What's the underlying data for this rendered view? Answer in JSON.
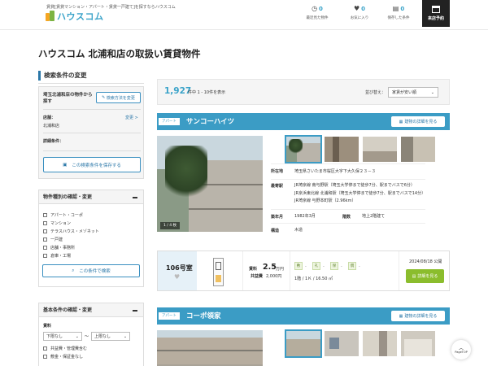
{
  "header": {
    "tagline": "賃貸[賃貸マンション・アパート・賃貸一戸建て]を探すならハウスコム",
    "logo_text": "ハウスコム",
    "recent": {
      "count": "0",
      "label": "最近見た物件"
    },
    "favorites": {
      "count": "0",
      "label": "お気に入り"
    },
    "saved": {
      "count": "0",
      "label": "保存した条件"
    },
    "visit_label": "来店予約"
  },
  "page_title": "ハウスコム 北浦和店の取扱い賃貸物件",
  "sidebar": {
    "heading": "検索条件の変更",
    "store_box": {
      "title": "埼玉北浦和店の物件から探す",
      "change_method": "検索方法を変更",
      "store_key": "店舗：",
      "store_edit": "変更 >",
      "store_value": "北浦和店",
      "detail_key": "詳細条件：",
      "save_button": "この検索条件を保存する"
    },
    "type_section": {
      "title": "物件種別の確認・変更",
      "options": [
        "アパート・コーポ",
        "マンション",
        "テラスハウス・メゾネット",
        "一戸建",
        "店舗・事務所",
        "倉庫・工場"
      ],
      "button": "この条件で検索"
    },
    "basic_section": {
      "title": "基本条件の確認・変更",
      "rent_label": "賃料",
      "rent_min": "下限なし",
      "rent_sep": "〜",
      "rent_max": "上限なし",
      "options": [
        "共益費・管理費含む",
        "敷金・保証金なし"
      ]
    }
  },
  "results": {
    "count": "1,927",
    "count_suffix": "件中 1 - 10件を表示",
    "sort_label": "並び替え：",
    "sort_value": "家賃が安い順"
  },
  "properties": [
    {
      "type": "アパート",
      "name": "サンコーハイツ",
      "detail_button": "建物の詳細を見る",
      "photo_counter": "1 / 4 枚",
      "address_label": "所在地",
      "address": "埼玉県さいたま市桜区大字下大久保２３－３",
      "station_label": "最寄駅",
      "stations": [
        "JR埼京線 南与野駅（埼玉大学停まで徒歩7分、駅までバスで6分）",
        "JR京浜東北線 北浦和駅（埼玉大学停まで徒歩7分、駅までバスで14分）",
        "JR埼京線 与野本町駅（2.96km）"
      ],
      "built_label": "築年月",
      "built": "1982年3月",
      "floors_label": "階数",
      "floors": "地上2階建て",
      "structure_label": "構造",
      "structure": "木造",
      "room": {
        "number": "106号室",
        "rent_label": "賃料",
        "rent_value": "2.5",
        "rent_unit": "万円",
        "fee_label": "共益費",
        "fee_value": "2,000円",
        "tags": [
          "敷",
          "礼",
          "保",
          "償"
        ],
        "tag_dash": "-",
        "layout": "1階 / 1Ｋ / 16.50 ㎡",
        "published": "2024/08/18 公開",
        "see_button": "詳細を見る"
      }
    },
    {
      "type": "アパート",
      "name": "コーポ領家",
      "detail_button": "建物の詳細を見る"
    }
  ],
  "pagetop_label": "PageTOP"
}
